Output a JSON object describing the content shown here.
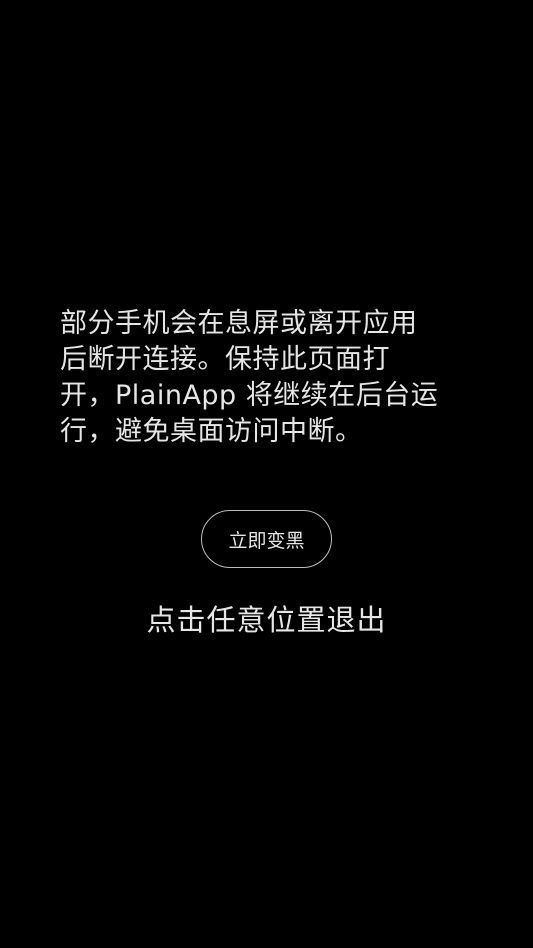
{
  "screen": {
    "background_color": "#000000",
    "text_color": "#e6e6e6"
  },
  "message": {
    "lines": [
      "部分手机会在息屏或离开应用",
      "后断开连接。保持此页面打",
      "开，PlainApp 将继续在后台运",
      "行，避免桌面访问中断。"
    ]
  },
  "blackout_button": {
    "label": "立即变黑",
    "border_color": "#bdbdbd"
  },
  "exit_hint": {
    "text": "点击任意位置退出"
  }
}
